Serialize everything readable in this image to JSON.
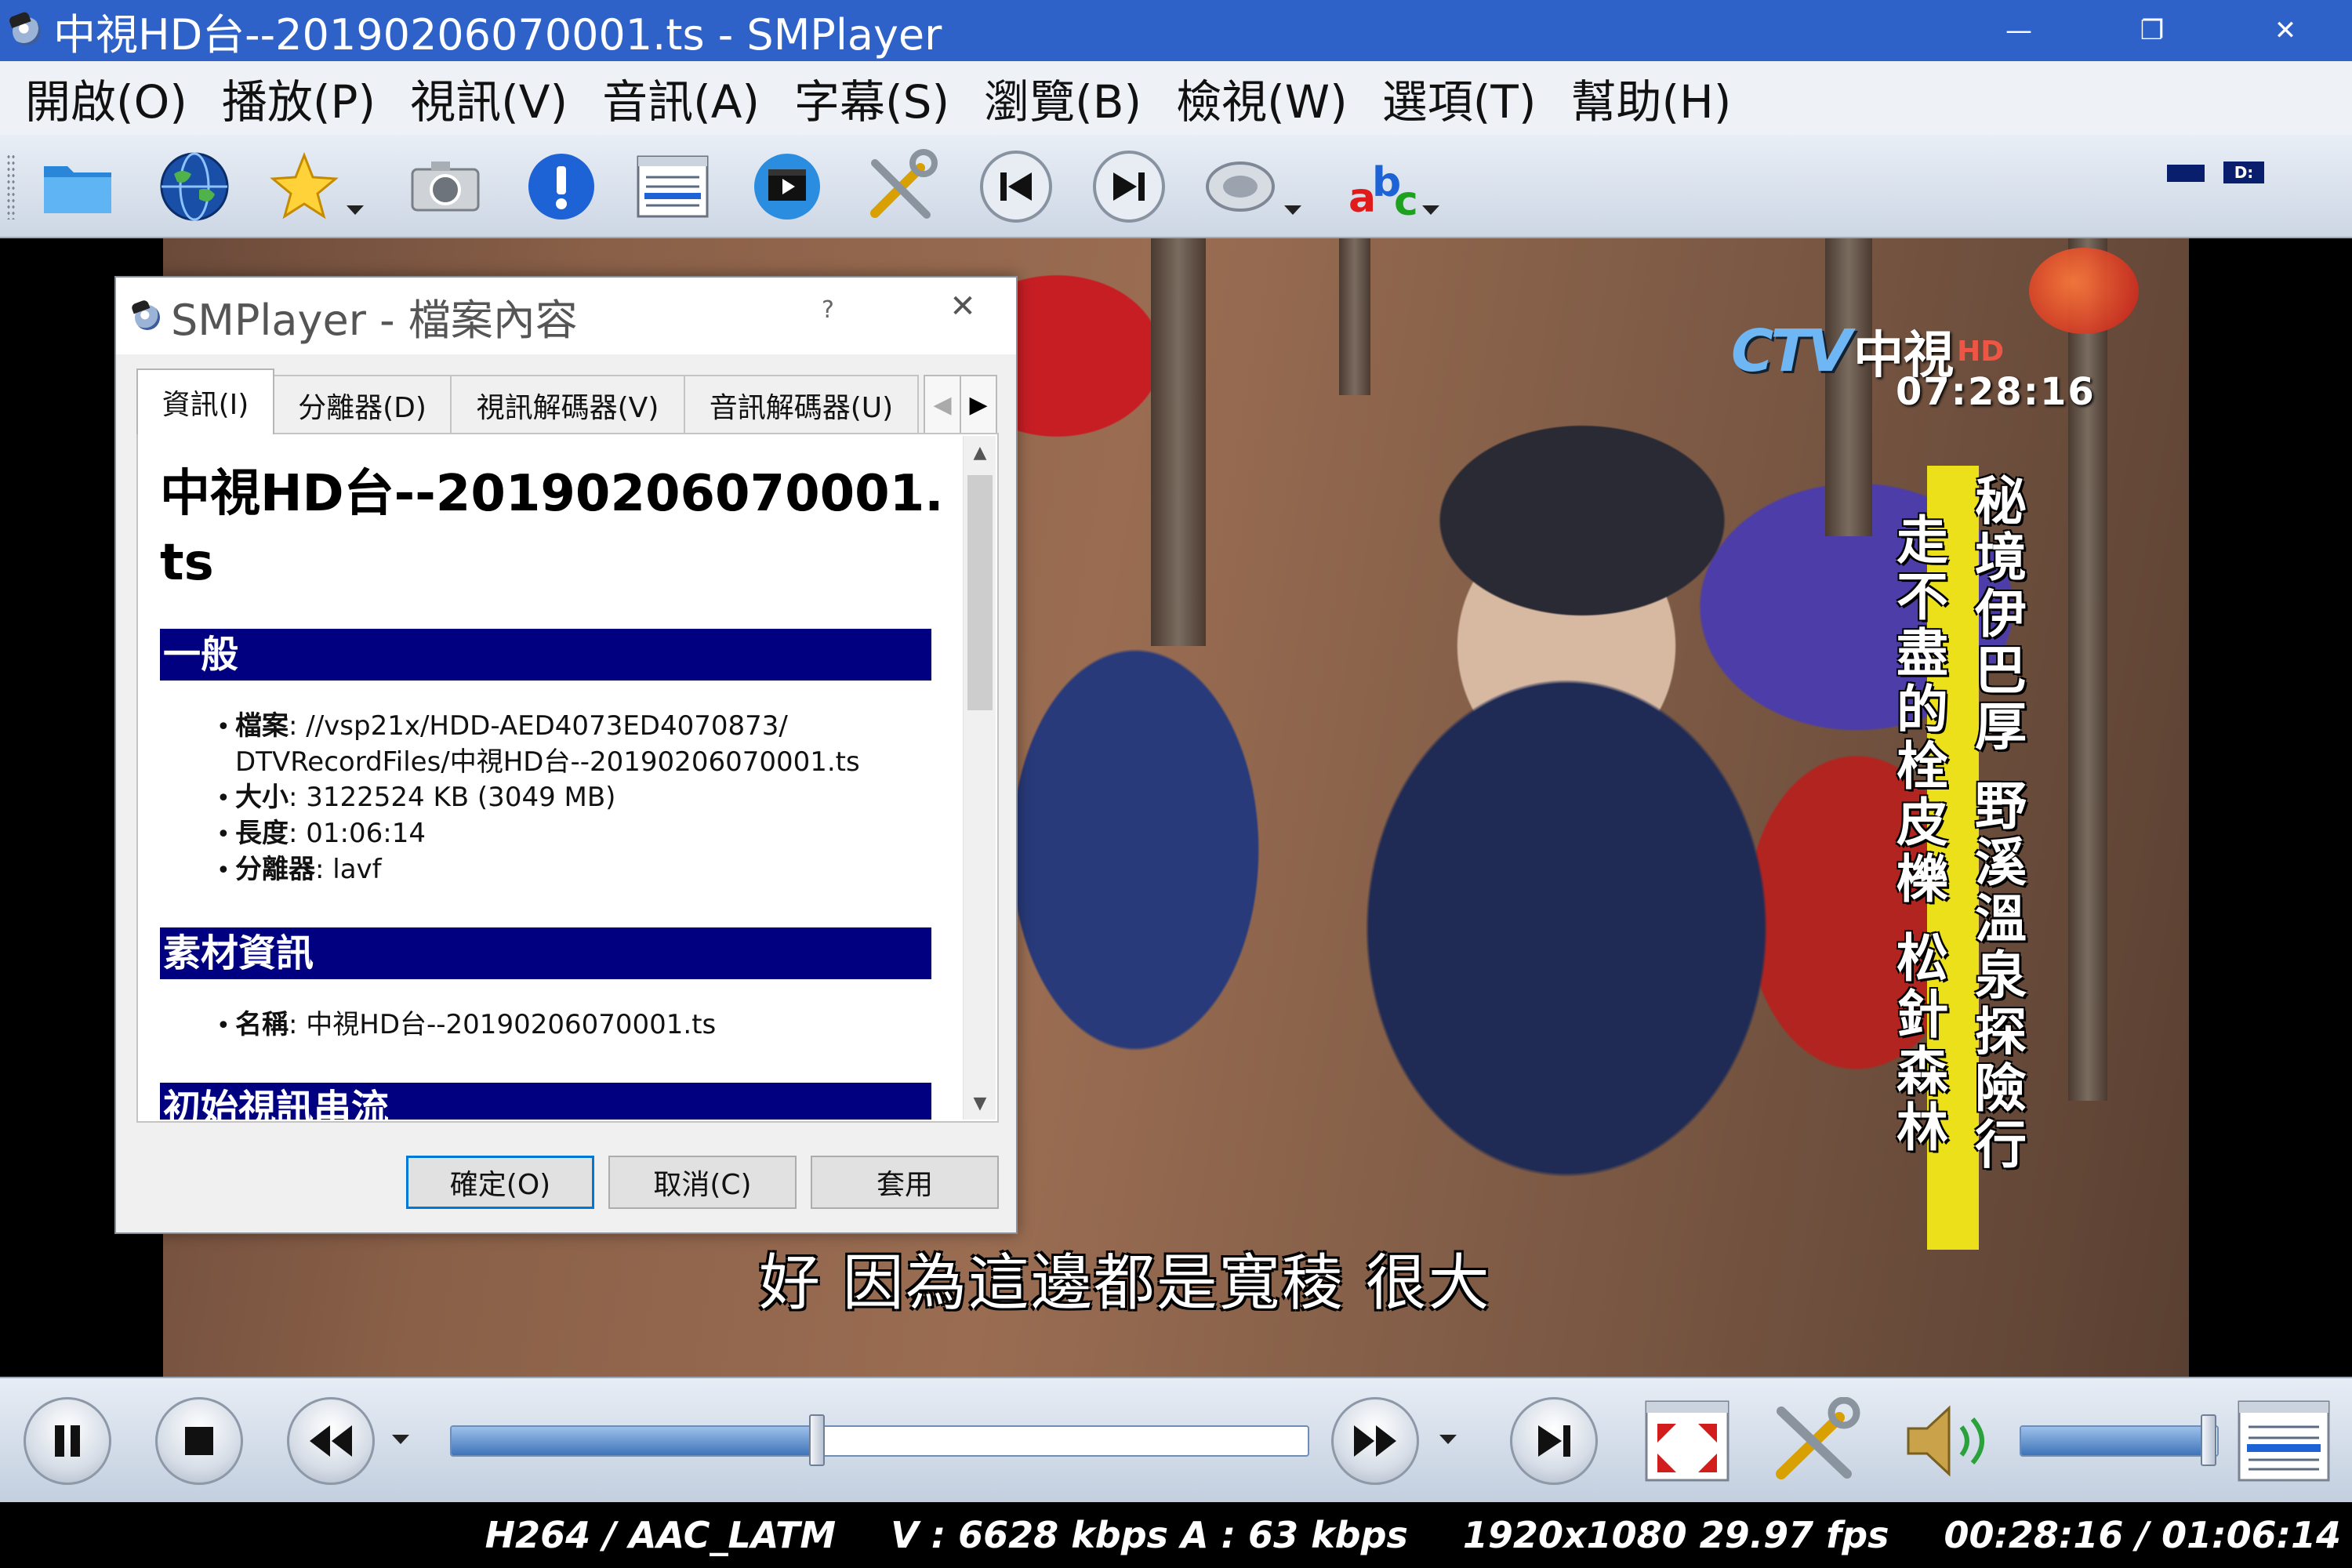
{
  "window": {
    "title": "中視HD台--20190206070001.ts - SMPlayer",
    "minimize": "—",
    "restore": "❐",
    "close": "✕"
  },
  "menu": [
    "開啟(O)",
    "播放(P)",
    "視訊(V)",
    "音訊(A)",
    "字幕(S)",
    "瀏覽(B)",
    "檢視(W)",
    "選項(T)",
    "幫助(H)"
  ],
  "toolbar": {
    "buttons": [
      "folder-icon",
      "globe-icon",
      "favorites-star-icon",
      "screenshot-camera-icon",
      "info-icon",
      "playlist-icon",
      "video-equalizer-icon",
      "preferences-tools-icon",
      "previous-chapter-icon",
      "next-chapter-icon",
      "audio-track-icon",
      "subtitles-abc-icon"
    ],
    "drive_label": "D:"
  },
  "video": {
    "channel_name": "中視",
    "channel_hd": "HD",
    "channel_logo": "CTV",
    "clock": "07:28:16",
    "caption_right": "秘境伊巴厚 野溪溫泉探險行",
    "caption_left": "走不盡的栓皮櫟 松針森林",
    "subtitle": "好 因為這邊都是寬稜 很大"
  },
  "dialog": {
    "title": "SMPlayer - 檔案內容",
    "help": "?",
    "close": "✕",
    "tabs": [
      "資訊(I)",
      "分離器(D)",
      "視訊解碼器(V)",
      "音訊解碼器(U)"
    ],
    "tab_scroll_left": "◀",
    "tab_scroll_right": "▶",
    "doc_title": "中視HD台--20190206070001.ts",
    "sections": [
      {
        "heading": "一般",
        "rows": [
          {
            "label": "檔案",
            "value": ": //vsp21x/HDD-AED4073ED4070873/",
            "value2": "DTVRecordFiles/中視HD台--20190206070001.ts"
          },
          {
            "label": "大小",
            "value": ": 3122524 KB (3049 MB)"
          },
          {
            "label": "長度",
            "value": ": 01:06:14"
          },
          {
            "label": "分離器",
            "value": ": lavf"
          }
        ]
      },
      {
        "heading": "素材資訊",
        "rows": [
          {
            "label": "名稱",
            "value": ": 中視HD台--20190206070001.ts"
          }
        ]
      },
      {
        "heading": "初始視訊串流",
        "rows": []
      }
    ],
    "buttons": {
      "ok": "確定(O)",
      "cancel": "取消(C)",
      "apply": "套用"
    },
    "scroll_up": "▲",
    "scroll_down": "▼"
  },
  "controls": {
    "seek_progress": 0.4266,
    "volume_level": 0.95
  },
  "status": {
    "codecs": "H264 / AAC_LATM",
    "bitrates": "V : 6628 kbps A : 63 kbps",
    "resolution": "1920x1080 29.97 fps",
    "time": "00:28:16 / 01:06:14"
  },
  "colors": {
    "titlebar": "#2f62c9",
    "section_header": "#000080",
    "accent_button": "#0078d7"
  }
}
